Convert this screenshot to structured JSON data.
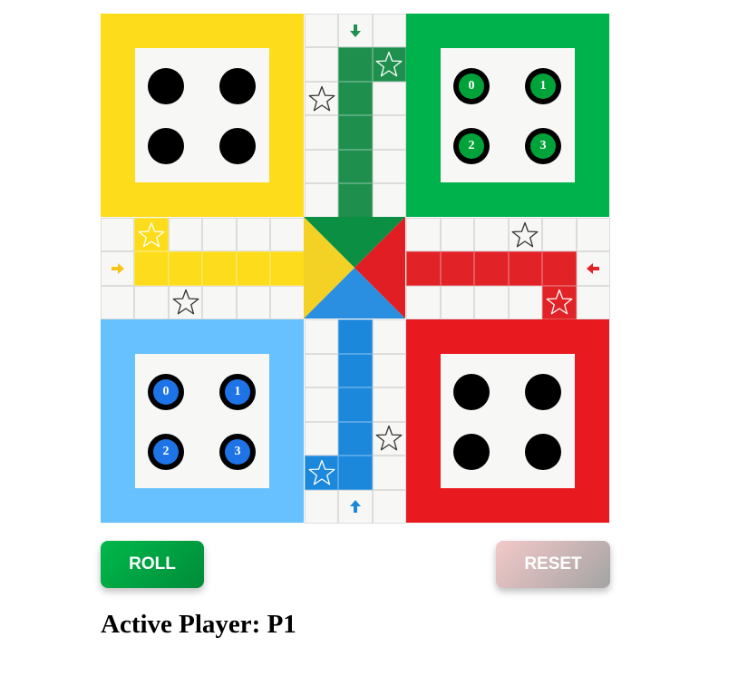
{
  "colors": {
    "yellow": "#fddc1c",
    "green": "#00b24b",
    "red": "#e8191f",
    "blue": "#66c1fe",
    "path_green": "#1f8f4e",
    "path_yellow": "#fddc1c",
    "path_red": "#e12227",
    "path_blue": "#1c88dc",
    "center_green": "#0b8f42",
    "center_yellow": "#f4d225",
    "center_red": "#e11e23",
    "center_blue": "#2a8fe0",
    "piece_green": "#00a339",
    "piece_blue": "#1e74e6"
  },
  "bases": {
    "yellow": {
      "pieces": [
        "",
        "",
        "",
        ""
      ]
    },
    "green": {
      "pieces": [
        "0",
        "1",
        "2",
        "3"
      ]
    },
    "blue": {
      "pieces": [
        "0",
        "1",
        "2",
        "3"
      ]
    },
    "red": {
      "pieces": [
        "",
        "",
        "",
        ""
      ]
    }
  },
  "icons": {
    "star": "star-icon",
    "arrow_down": "arrow-down-icon",
    "arrow_right": "arrow-right-icon",
    "arrow_left": "arrow-left-icon",
    "arrow_up": "arrow-up-icon"
  },
  "controls": {
    "roll_label": "ROLL",
    "reset_label": "RESET"
  },
  "status": {
    "text": "Active Player: P1"
  }
}
